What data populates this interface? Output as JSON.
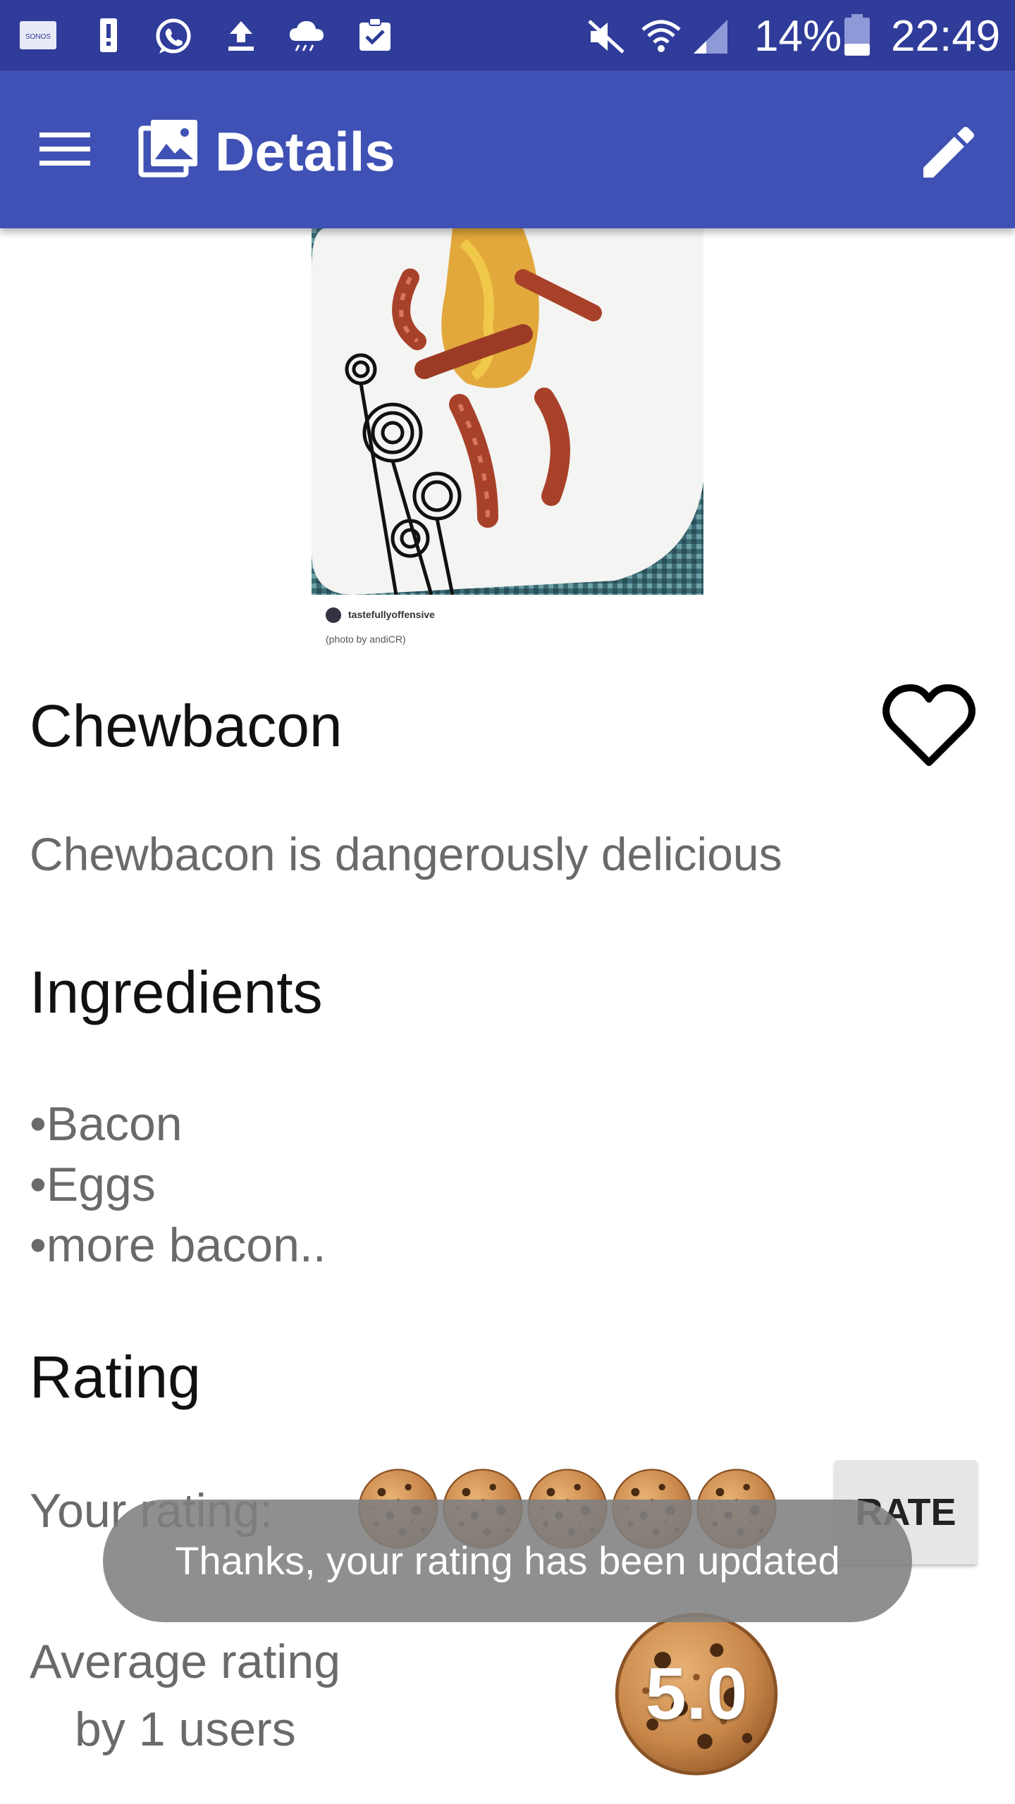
{
  "status_bar": {
    "icons": [
      "sonos-icon",
      "battery-alert-icon",
      "whatsapp-icon",
      "upload-icon",
      "weather-icon",
      "clipboard-check-icon",
      "mute-icon",
      "wifi-icon",
      "signal-icon",
      "battery-icon"
    ],
    "sonos_text": "SONOS",
    "battery_percent": "14%",
    "time": "22:49"
  },
  "toolbar": {
    "title": "Details",
    "menu_icon": "menu-icon",
    "title_icon": "image-icon",
    "edit_icon": "edit-icon",
    "color": "#3f51b5"
  },
  "photo": {
    "caption_handle": "tastefullyoffensive",
    "caption_credit": "(photo by andiCR)"
  },
  "recipe": {
    "title": "Chewbacon",
    "favorite_icon": "heart-outline-icon",
    "description": "Chewbacon is dangerously delicious"
  },
  "ingredients": {
    "heading": "Ingredients",
    "items": [
      "•Bacon",
      "•Eggs",
      "•more bacon.."
    ]
  },
  "rating": {
    "heading": "Rating",
    "your_rating_label": "Your rating:",
    "your_rating_value": 5,
    "your_rating_max": 5,
    "rate_button": "RATE",
    "average_label_line1": "Average rating",
    "average_label_line2": "by 1 users",
    "average_value": "5.0",
    "icon": "cookie-icon"
  },
  "toast": {
    "message": "Thanks, your rating has been updated"
  }
}
